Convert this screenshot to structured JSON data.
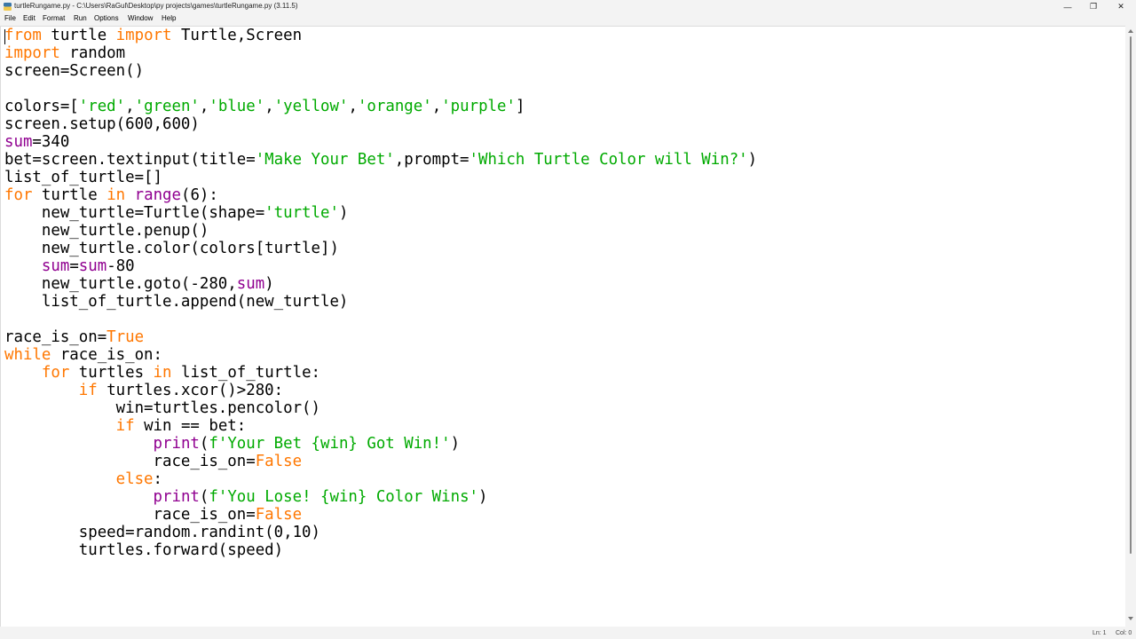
{
  "window": {
    "title": "turtleRungame.py - C:\\Users\\RaGul\\Desktop\\py projects\\games\\turtleRungame.py (3.11.5)",
    "minimize_glyph": "—",
    "maximize_glyph": "❐",
    "close_glyph": "✕"
  },
  "menu": {
    "file": "File",
    "edit": "Edit",
    "format": "Format",
    "run": "Run",
    "options": "Options",
    "window": "Window",
    "help": "Help"
  },
  "status": {
    "line": "Ln: 1",
    "col": "Col: 0"
  },
  "editor": {
    "syntax_colors": {
      "keyword": "#ff7700",
      "builtin": "#900090",
      "string": "#00aa00",
      "default": "#000000"
    },
    "lines": [
      [
        {
          "t": "from",
          "c": "kw"
        },
        {
          "t": " turtle "
        },
        {
          "t": "import",
          "c": "kw"
        },
        {
          "t": " Turtle,Screen"
        }
      ],
      [
        {
          "t": "import",
          "c": "kw"
        },
        {
          "t": " random"
        }
      ],
      [
        {
          "t": "screen=Screen()"
        }
      ],
      [],
      [
        {
          "t": "colors=["
        },
        {
          "t": "'red'",
          "c": "st"
        },
        {
          "t": ","
        },
        {
          "t": "'green'",
          "c": "st"
        },
        {
          "t": ","
        },
        {
          "t": "'blue'",
          "c": "st"
        },
        {
          "t": ","
        },
        {
          "t": "'yellow'",
          "c": "st"
        },
        {
          "t": ","
        },
        {
          "t": "'orange'",
          "c": "st"
        },
        {
          "t": ","
        },
        {
          "t": "'purple'",
          "c": "st"
        },
        {
          "t": "]"
        }
      ],
      [
        {
          "t": "screen.setup(600,600)"
        }
      ],
      [
        {
          "t": "sum",
          "c": "bi"
        },
        {
          "t": "=340"
        }
      ],
      [
        {
          "t": "bet=screen.textinput(title="
        },
        {
          "t": "'Make Your Bet'",
          "c": "st"
        },
        {
          "t": ",prompt="
        },
        {
          "t": "'Which Turtle Color will Win?'",
          "c": "st"
        },
        {
          "t": ")"
        }
      ],
      [
        {
          "t": "list_of_turtle=[]"
        }
      ],
      [
        {
          "t": "for",
          "c": "kw"
        },
        {
          "t": " turtle "
        },
        {
          "t": "in",
          "c": "kw"
        },
        {
          "t": " "
        },
        {
          "t": "range",
          "c": "bi"
        },
        {
          "t": "(6):"
        }
      ],
      [
        {
          "t": "    new_turtle=Turtle(shape="
        },
        {
          "t": "'turtle'",
          "c": "st"
        },
        {
          "t": ")"
        }
      ],
      [
        {
          "t": "    new_turtle.penup()"
        }
      ],
      [
        {
          "t": "    new_turtle.color(colors[turtle])"
        }
      ],
      [
        {
          "t": "    "
        },
        {
          "t": "sum",
          "c": "bi"
        },
        {
          "t": "="
        },
        {
          "t": "sum",
          "c": "bi"
        },
        {
          "t": "-80"
        }
      ],
      [
        {
          "t": "    new_turtle.goto(-280,"
        },
        {
          "t": "sum",
          "c": "bi"
        },
        {
          "t": ")"
        }
      ],
      [
        {
          "t": "    list_of_turtle.append(new_turtle)"
        }
      ],
      [],
      [
        {
          "t": "race_is_on="
        },
        {
          "t": "True",
          "c": "kw"
        }
      ],
      [
        {
          "t": "while",
          "c": "kw"
        },
        {
          "t": " race_is_on:"
        }
      ],
      [
        {
          "t": "    "
        },
        {
          "t": "for",
          "c": "kw"
        },
        {
          "t": " turtles "
        },
        {
          "t": "in",
          "c": "kw"
        },
        {
          "t": " list_of_turtle:"
        }
      ],
      [
        {
          "t": "        "
        },
        {
          "t": "if",
          "c": "kw"
        },
        {
          "t": " turtles.xcor()>280:"
        }
      ],
      [
        {
          "t": "            win=turtles.pencolor()"
        }
      ],
      [
        {
          "t": "            "
        },
        {
          "t": "if",
          "c": "kw"
        },
        {
          "t": " win == bet:"
        }
      ],
      [
        {
          "t": "                "
        },
        {
          "t": "print",
          "c": "bi"
        },
        {
          "t": "("
        },
        {
          "t": "f'Your Bet {win} Got Win!'",
          "c": "st"
        },
        {
          "t": ")"
        }
      ],
      [
        {
          "t": "                race_is_on="
        },
        {
          "t": "False",
          "c": "kw"
        }
      ],
      [
        {
          "t": "            "
        },
        {
          "t": "else",
          "c": "kw"
        },
        {
          "t": ":"
        }
      ],
      [
        {
          "t": "                "
        },
        {
          "t": "print",
          "c": "bi"
        },
        {
          "t": "("
        },
        {
          "t": "f'You Lose! {win} Color Wins'",
          "c": "st"
        },
        {
          "t": ")"
        }
      ],
      [
        {
          "t": "                race_is_on="
        },
        {
          "t": "False",
          "c": "kw"
        }
      ],
      [
        {
          "t": "        speed=random.randint(0,10)"
        }
      ],
      [
        {
          "t": "        turtles.forward(speed)"
        }
      ]
    ]
  }
}
